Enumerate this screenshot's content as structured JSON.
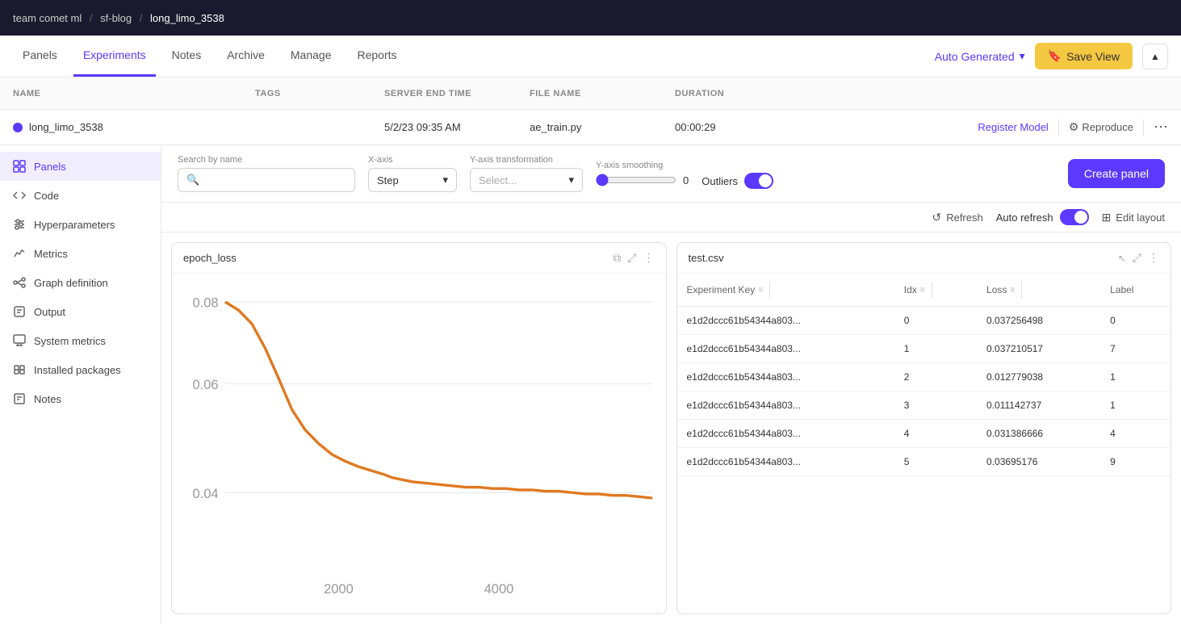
{
  "topbar": {
    "breadcrumb_team": "team comet ml",
    "sep1": "/",
    "breadcrumb_project": "sf-blog",
    "sep2": "/",
    "breadcrumb_experiment": "long_limo_3538"
  },
  "nav": {
    "tabs": [
      {
        "id": "panels",
        "label": "Panels",
        "active": false
      },
      {
        "id": "experiments",
        "label": "Experiments",
        "active": true
      },
      {
        "id": "notes",
        "label": "Notes",
        "active": false
      },
      {
        "id": "archive",
        "label": "Archive",
        "active": false
      },
      {
        "id": "manage",
        "label": "Manage",
        "active": false
      },
      {
        "id": "reports",
        "label": "Reports",
        "active": false
      }
    ],
    "auto_generated_label": "Auto Generated",
    "save_view_label": "Save View"
  },
  "table_header": {
    "name": "NAME",
    "tags": "TAGS",
    "server_end_time": "SERVER END TIME",
    "file_name": "FILE NAME",
    "duration": "DURATION"
  },
  "experiment_row": {
    "name": "long_limo_3538",
    "tags": "",
    "server_end_time": "5/2/23 09:35 AM",
    "file_name": "ae_train.py",
    "duration": "00:00:29",
    "register_label": "Register Model",
    "reproduce_label": "Reproduce"
  },
  "sidebar": {
    "items": [
      {
        "id": "panels",
        "label": "Panels",
        "icon": "panels-icon",
        "active": true
      },
      {
        "id": "code",
        "label": "Code",
        "icon": "code-icon",
        "active": false
      },
      {
        "id": "hyperparameters",
        "label": "Hyperparameters",
        "icon": "hyperparameters-icon",
        "active": false
      },
      {
        "id": "metrics",
        "label": "Metrics",
        "icon": "metrics-icon",
        "active": false
      },
      {
        "id": "graph-definition",
        "label": "Graph definition",
        "icon": "graph-icon",
        "active": false
      },
      {
        "id": "output",
        "label": "Output",
        "icon": "output-icon",
        "active": false
      },
      {
        "id": "system-metrics",
        "label": "System metrics",
        "icon": "system-icon",
        "active": false
      },
      {
        "id": "installed-packages",
        "label": "Installed packages",
        "icon": "packages-icon",
        "active": false
      },
      {
        "id": "notes",
        "label": "Notes",
        "icon": "notes-icon",
        "active": false
      }
    ]
  },
  "controls": {
    "search_label": "Search by name",
    "search_placeholder": "",
    "xaxis_label": "X-axis",
    "xaxis_value": "Step",
    "yaxis_transform_label": "Y-axis transformation",
    "yaxis_transform_placeholder": "Select...",
    "yaxis_smoothing_label": "Y-axis smoothing",
    "smoothing_value": "0",
    "outliers_label": "Outliers",
    "create_panel_label": "Create panel"
  },
  "actions": {
    "refresh_label": "Refresh",
    "auto_refresh_label": "Auto refresh",
    "edit_layout_label": "Edit layout"
  },
  "chart_panel": {
    "title": "epoch_loss"
  },
  "table_panel": {
    "title": "test.csv",
    "columns": [
      "Experiment Key",
      "Idx",
      "Loss",
      "Label"
    ],
    "rows": [
      {
        "key": "e1d2dccc61b54344a803...",
        "idx": "0",
        "loss": "0.037256498",
        "label": "0"
      },
      {
        "key": "e1d2dccc61b54344a803...",
        "idx": "1",
        "loss": "0.037210517",
        "label": "7"
      },
      {
        "key": "e1d2dccc61b54344a803...",
        "idx": "2",
        "loss": "0.012779038",
        "label": "1"
      },
      {
        "key": "e1d2dccc61b54344a803...",
        "idx": "3",
        "loss": "0.011142737",
        "label": "1"
      },
      {
        "key": "e1d2dccc61b54344a803...",
        "idx": "4",
        "loss": "0.031386666",
        "label": "4"
      },
      {
        "key": "e1d2dccc61b54344a803...",
        "idx": "5",
        "loss": "0.03695176",
        "label": "9"
      }
    ]
  },
  "colors": {
    "accent": "#5c39ff",
    "chart_line": "#e07820",
    "save_view_bg": "#f5c842"
  }
}
